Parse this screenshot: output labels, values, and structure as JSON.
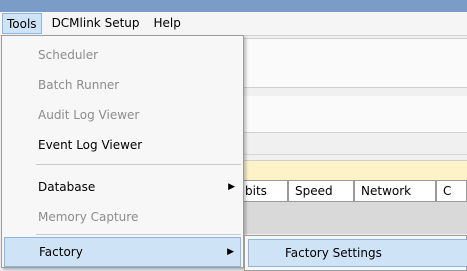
{
  "menubar": {
    "items": [
      {
        "label": "Tools"
      },
      {
        "label": "DCMlink Setup"
      },
      {
        "label": "Help"
      }
    ]
  },
  "tools_menu": {
    "items": [
      {
        "label": "Scheduler",
        "enabled": false
      },
      {
        "label": "Batch Runner",
        "enabled": false
      },
      {
        "label": "Audit Log Viewer",
        "enabled": false
      },
      {
        "label": "Event Log Viewer",
        "enabled": true
      },
      {
        "label": "Database",
        "enabled": true,
        "submenu_arrow": "▶"
      },
      {
        "label": "Memory Capture",
        "enabled": false
      },
      {
        "label": "Factory",
        "enabled": true,
        "submenu_arrow": "▶"
      }
    ]
  },
  "factory_submenu": {
    "items": [
      {
        "label": "Factory Settings"
      }
    ]
  },
  "background_table": {
    "headers": [
      "bits",
      "Speed",
      "Network",
      "C"
    ]
  },
  "colors": {
    "highlight": "#cfe3f7",
    "highlight_border": "#8eb5dd",
    "disabled_text": "#8c8c8c",
    "title_stripe": "#7a9cc7",
    "yellow_bar": "#fdf2c8"
  }
}
